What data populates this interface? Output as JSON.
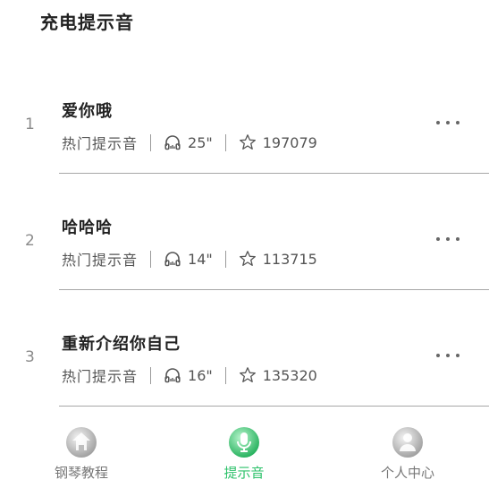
{
  "header": {
    "title": "充电提示音"
  },
  "items": [
    {
      "index": "1",
      "title": "爱你哦",
      "category": "热门提示音",
      "duration": "25\"",
      "favorites": "197079"
    },
    {
      "index": "2",
      "title": "哈哈哈",
      "category": "热门提示音",
      "duration": "14\"",
      "favorites": "113715"
    },
    {
      "index": "3",
      "title": "重新介绍你自己",
      "category": "热门提示音",
      "duration": "16\"",
      "favorites": "135320"
    }
  ],
  "icons": {
    "duration": "headphones-icon",
    "favorites": "star-icon",
    "more": "more-dots-icon"
  },
  "tabbar": {
    "tabs": [
      {
        "label": "钢琴教程",
        "icon": "piano-icon",
        "active": false
      },
      {
        "label": "提示音",
        "icon": "ringtone-icon",
        "active": true
      },
      {
        "label": "个人中心",
        "icon": "profile-icon",
        "active": false
      }
    ],
    "active_color": "#2ec26b",
    "inactive_color": "#777777"
  }
}
